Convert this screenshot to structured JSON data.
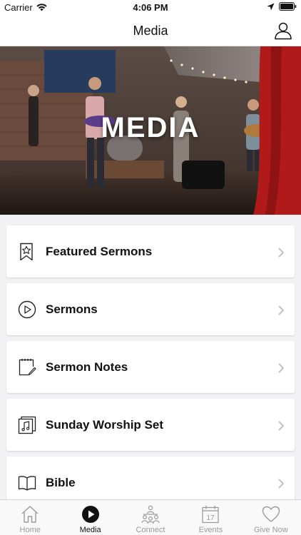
{
  "status": {
    "carrier": "Carrier",
    "time": "4:06 PM"
  },
  "nav": {
    "title": "Media"
  },
  "hero": {
    "title": "MEDIA"
  },
  "menu": [
    {
      "label": "Featured Sermons",
      "icon": "bookmark-star-icon"
    },
    {
      "label": "Sermons",
      "icon": "play-circle-icon"
    },
    {
      "label": "Sermon Notes",
      "icon": "notepad-pencil-icon"
    },
    {
      "label": "Sunday Worship Set",
      "icon": "music-note-album-icon"
    },
    {
      "label": "Bible",
      "icon": "open-book-icon"
    }
  ],
  "tabs": [
    {
      "label": "Home",
      "icon": "home-icon",
      "active": false
    },
    {
      "label": "Media",
      "icon": "play-circle-filled-icon",
      "active": true
    },
    {
      "label": "Connect",
      "icon": "people-icon",
      "active": false
    },
    {
      "label": "Events",
      "icon": "calendar-icon",
      "active": false
    },
    {
      "label": "Give Now",
      "icon": "heart-icon",
      "active": false
    }
  ],
  "events_calendar_day": "17"
}
